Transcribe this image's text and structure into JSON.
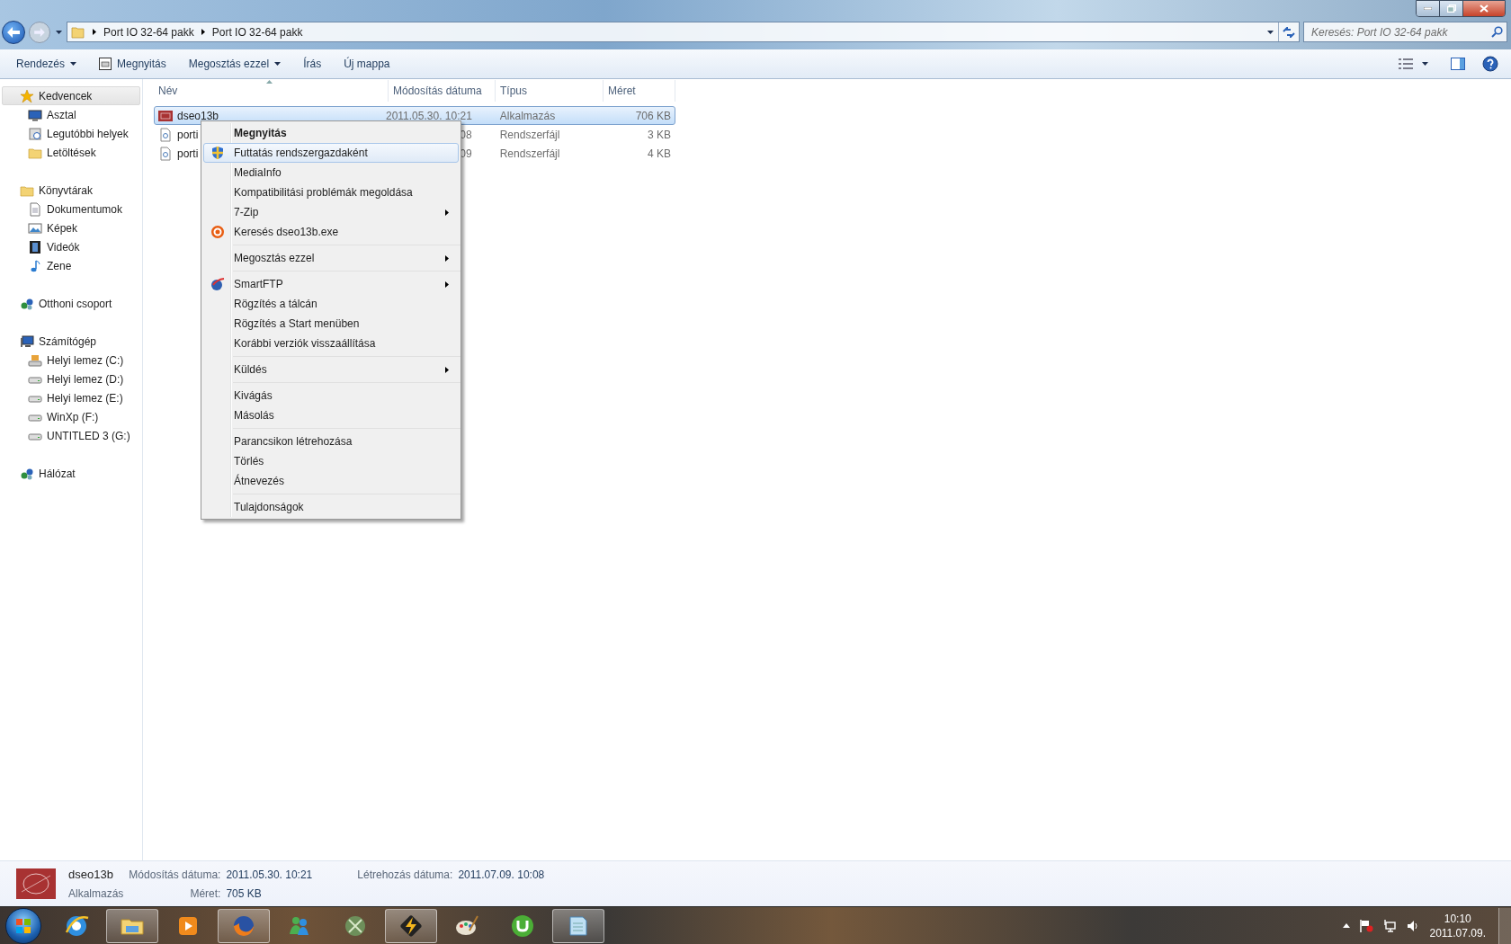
{
  "address_bar": {
    "crumbs": [
      "Port IO 32-64 pakk",
      "Port IO 32-64 pakk"
    ]
  },
  "search": {
    "placeholder": "Keresés: Port IO 32-64 pakk"
  },
  "toolbar": [
    {
      "label": "Rendezés",
      "dropdown": true
    },
    {
      "label": "Megnyitás",
      "dropdown": false
    },
    {
      "label": "Megosztás ezzel",
      "dropdown": true
    },
    {
      "label": "Írás",
      "dropdown": false
    },
    {
      "label": "Új mappa",
      "dropdown": false
    }
  ],
  "sidebar": [
    {
      "label": "Kedvencek",
      "selected": true,
      "children": [
        {
          "label": "Asztal",
          "selected": false
        },
        {
          "label": "Legutóbbi helyek",
          "selected": false
        },
        {
          "label": "Letöltések",
          "selected": false
        }
      ]
    },
    {
      "label": "Könyvtárak",
      "selected": false,
      "children": [
        {
          "label": "Dokumentumok",
          "selected": false
        },
        {
          "label": "Képek",
          "selected": false
        },
        {
          "label": "Videók",
          "selected": false
        },
        {
          "label": "Zene",
          "selected": false
        }
      ]
    },
    {
      "label": "Otthoni csoport",
      "selected": false
    },
    {
      "label": "Számítógép",
      "selected": false,
      "children": [
        {
          "label": "Helyi lemez (C:)",
          "selected": false
        },
        {
          "label": "Helyi lemez (D:)",
          "selected": false
        },
        {
          "label": "Helyi lemez (E:)",
          "selected": false
        },
        {
          "label": "WinXp (F:)",
          "selected": false
        },
        {
          "label": "UNTITLED 3 (G:)",
          "selected": false
        }
      ]
    },
    {
      "label": "Hálózat",
      "selected": false
    }
  ],
  "table": {
    "columns": [
      "Név",
      "Módosítás dátuma",
      "Típus",
      "Méret"
    ],
    "rows": [
      {
        "name": "dseo13b",
        "date": "2011.05.30. 10:21",
        "type": "Alkalmazás",
        "size": "706 KB",
        "selected": true
      },
      {
        "name": "porti",
        "date": "08",
        "type": "Rendszerfájl",
        "size": "3 KB",
        "selected": false
      },
      {
        "name": "porti",
        "date": "09",
        "type": "Rendszerfájl",
        "size": "4 KB",
        "selected": false
      }
    ]
  },
  "context_menu": {
    "groups": [
      [
        {
          "label": "Megnyitás",
          "default": true,
          "submenu": false,
          "selected": false
        },
        {
          "label": "Futtatás rendszergazdaként",
          "default": false,
          "submenu": false,
          "selected": true
        },
        {
          "label": "MediaInfo",
          "default": false,
          "submenu": false,
          "selected": false
        },
        {
          "label": "Kompatibilitási problémák megoldása",
          "default": false,
          "submenu": false,
          "selected": false
        },
        {
          "label": "7-Zip",
          "default": false,
          "submenu": true,
          "selected": false
        },
        {
          "label": "Keresés dseo13b.exe",
          "default": false,
          "submenu": false,
          "selected": false
        }
      ],
      [
        {
          "label": "Megosztás ezzel",
          "default": false,
          "submenu": true,
          "selected": false
        }
      ],
      [
        {
          "label": "SmartFTP",
          "default": false,
          "submenu": true,
          "selected": false
        },
        {
          "label": "Rögzítés a tálcán",
          "default": false,
          "submenu": false,
          "selected": false
        },
        {
          "label": "Rögzítés a Start menüben",
          "default": false,
          "submenu": false,
          "selected": false
        },
        {
          "label": "Korábbi verziók visszaállítása",
          "default": false,
          "submenu": false,
          "selected": false
        }
      ],
      [
        {
          "label": "Küldés",
          "default": false,
          "submenu": true,
          "selected": false
        }
      ],
      [
        {
          "label": "Kivágás",
          "default": false,
          "submenu": false,
          "selected": false
        },
        {
          "label": "Másolás",
          "default": false,
          "submenu": false,
          "selected": false
        }
      ],
      [
        {
          "label": "Parancsikon létrehozása",
          "default": false,
          "submenu": false,
          "selected": false
        },
        {
          "label": "Törlés",
          "default": false,
          "submenu": false,
          "selected": false
        },
        {
          "label": "Átnevezés",
          "default": false,
          "submenu": false,
          "selected": false
        }
      ],
      [
        {
          "label": "Tulajdonságok",
          "default": false,
          "submenu": false,
          "selected": false
        }
      ]
    ]
  },
  "details": {
    "name": "dseo13b",
    "type": "Alkalmazás",
    "fields": [
      {
        "label": "Módosítás dátuma:",
        "value": "2011.05.30. 10:21"
      },
      {
        "label": "Méret:",
        "value": "705 KB"
      },
      {
        "label": "Létrehozás dátuma:",
        "value": "2011.07.09. 10:08"
      }
    ]
  },
  "taskbar": {
    "apps": [
      {
        "running": false
      },
      {
        "running": true
      },
      {
        "running": false
      },
      {
        "running": true
      },
      {
        "running": false
      },
      {
        "running": false
      },
      {
        "running": true
      },
      {
        "running": false
      },
      {
        "running": false
      },
      {
        "running": true
      }
    ],
    "time": "10:10",
    "date": "2011.07.09."
  }
}
